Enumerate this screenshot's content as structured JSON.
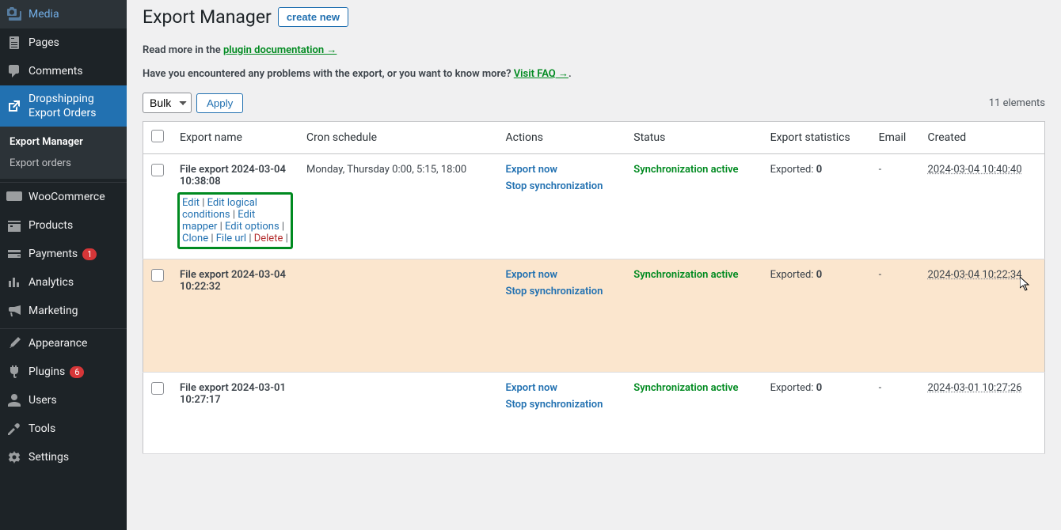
{
  "sidebar": {
    "items": [
      {
        "icon": "media",
        "label": "Media"
      },
      {
        "icon": "pages",
        "label": "Pages"
      },
      {
        "icon": "comments",
        "label": "Comments"
      },
      {
        "icon": "export",
        "label": "Dropshipping Export Orders",
        "active": true
      },
      {
        "icon": "woo",
        "label": "WooCommerce"
      },
      {
        "icon": "products",
        "label": "Products"
      },
      {
        "icon": "payments",
        "label": "Payments",
        "badge": "1"
      },
      {
        "icon": "analytics",
        "label": "Analytics"
      },
      {
        "icon": "marketing",
        "label": "Marketing"
      },
      {
        "icon": "appearance",
        "label": "Appearance"
      },
      {
        "icon": "plugins",
        "label": "Plugins",
        "badge": "6"
      },
      {
        "icon": "users",
        "label": "Users"
      },
      {
        "icon": "tools",
        "label": "Tools"
      },
      {
        "icon": "settings",
        "label": "Settings"
      }
    ],
    "submenu": [
      {
        "label": "Export Manager",
        "current": true
      },
      {
        "label": "Export orders"
      }
    ]
  },
  "page": {
    "title": "Export Manager",
    "create_btn": "create new",
    "intro1_prefix": "Read more in the ",
    "intro1_link": "plugin documentation →",
    "intro2_prefix": "Have you encountered any problems with the export, or you want to know more? ",
    "intro2_link": "Visit FAQ →",
    "intro2_suffix": ".",
    "bulk_label": "Bulk",
    "apply_label": "Apply",
    "elements_count": "11 elements"
  },
  "table": {
    "headers": {
      "name": "Export name",
      "cron": "Cron schedule",
      "actions": "Actions",
      "status": "Status",
      "stats": "Export statistics",
      "email": "Email",
      "created": "Created"
    },
    "action_links": {
      "export_now": "Export now",
      "stop_sync": "Stop synchronization"
    },
    "status_active": "Synchronization active",
    "exported_prefix": "Exported: ",
    "row_actions": {
      "edit": "Edit",
      "edit_logical": "Edit logical conditions",
      "edit_mapper": "Edit mapper",
      "edit_options": "Edit options",
      "clone": "Clone",
      "file_url": "File url",
      "delete": "Delete"
    },
    "rows": [
      {
        "name": "File export 2024-03-04 10:38:08",
        "cron": "Monday, Thursday 0:00, 5:15, 18:00",
        "exported": "0",
        "email": "-",
        "created": "2024-03-04 10:40:40",
        "show_actions": true
      },
      {
        "name": "File export 2024-03-04 10:22:32",
        "cron": "",
        "exported": "0",
        "email": "-",
        "created": "2024-03-04 10:22:34",
        "alt": true
      },
      {
        "name": "File export 2024-03-01 10:27:17",
        "cron": "",
        "exported": "0",
        "email": "-",
        "created": "2024-03-01 10:27:26"
      }
    ]
  }
}
